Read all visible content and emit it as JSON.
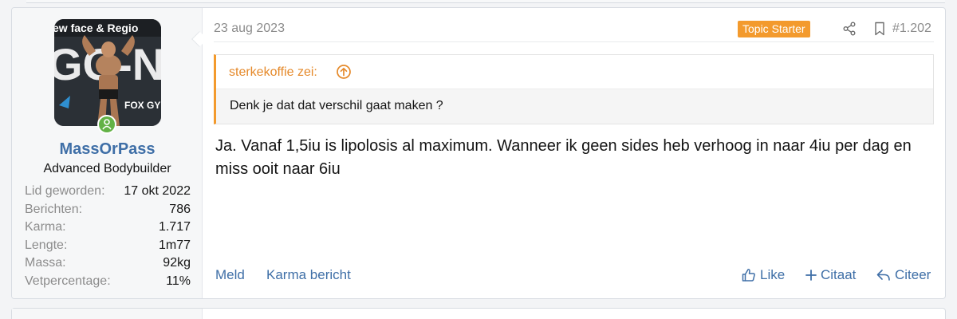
{
  "post": {
    "date": "23 aug 2023",
    "badge": "Topic Starter",
    "number": "#1.202",
    "icons": {
      "share": "share-icon",
      "bookmark": "bookmark-icon"
    }
  },
  "user": {
    "avatar_text": "ew face & Regio",
    "avatar_banner": "GG-N",
    "avatar_sponsor": "FOX GYM",
    "name": "MassOrPass",
    "title": "Advanced Bodybuilder",
    "status": "online",
    "stats": [
      {
        "label": "Lid geworden:",
        "value": "17 okt 2022"
      },
      {
        "label": "Berichten:",
        "value": "786"
      },
      {
        "label": "Karma:",
        "value": "1.717"
      },
      {
        "label": "Lengte:",
        "value": "1m77"
      },
      {
        "label": "Massa:",
        "value": "92kg"
      },
      {
        "label": "Vetpercentage:",
        "value": "11%"
      }
    ]
  },
  "quote": {
    "author": "sterkekoffie zei:",
    "text": "Denk je dat dat verschil gaat maken ?"
  },
  "message": "Ja. Vanaf 1,5iu is lipolosis al maximum. Wanneer ik geen sides heb verhoog in naar 4iu per dag en miss ooit naar 6iu",
  "footer": {
    "report": "Meld",
    "karma": "Karma bericht",
    "like": "Like",
    "multi_quote": "Citaat",
    "reply": "Citeer"
  },
  "colors": {
    "accent": "#f39a2d",
    "link": "#3f6fa7",
    "online": "#63b246"
  }
}
